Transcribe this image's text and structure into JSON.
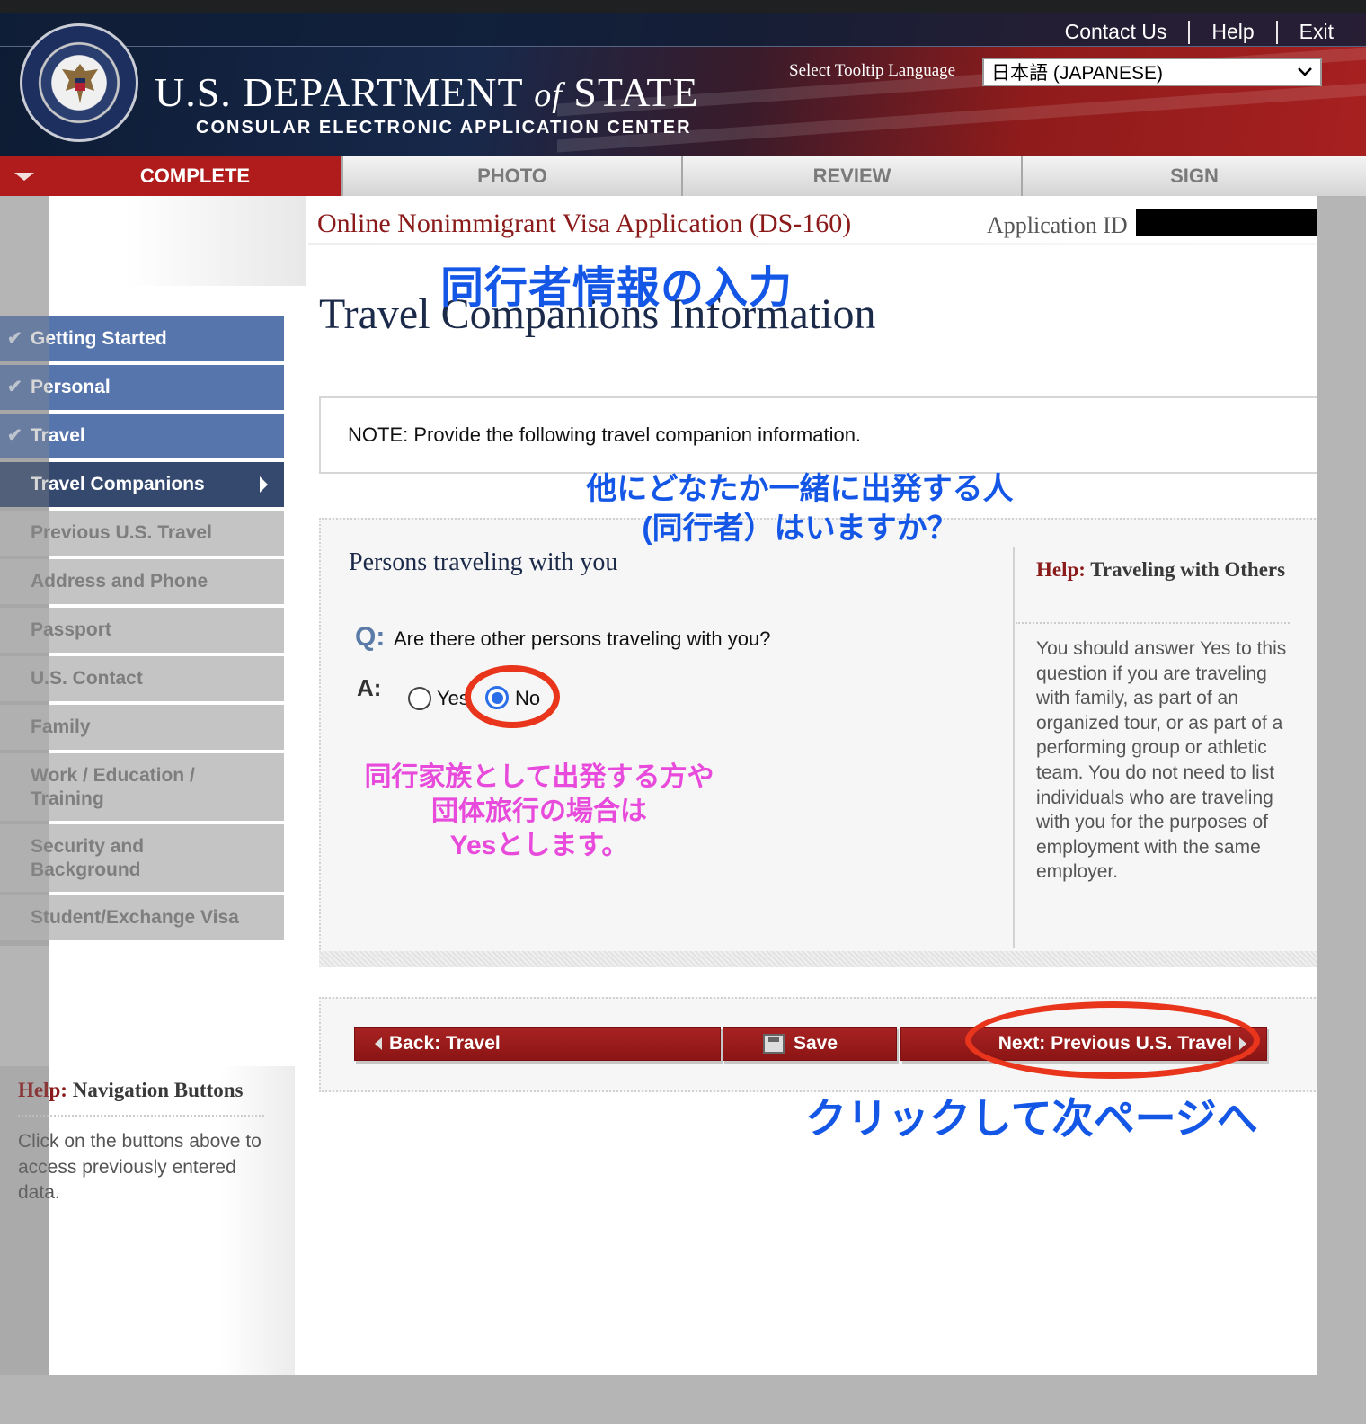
{
  "header": {
    "links": [
      "Contact Us",
      "Help",
      "Exit"
    ],
    "dept_title_part1": "U.S. DEPARTMENT",
    "dept_title_of": "of",
    "dept_title_part2": "STATE",
    "dept_subtitle": "CONSULAR ELECTRONIC APPLICATION CENTER",
    "tooltip_label": "Select Tooltip Language",
    "tooltip_value": "日本語 (JAPANESE)"
  },
  "tabs": [
    {
      "label": "COMPLETE",
      "active": true
    },
    {
      "label": "PHOTO",
      "active": false
    },
    {
      "label": "REVIEW",
      "active": false
    },
    {
      "label": "SIGN",
      "active": false
    }
  ],
  "app": {
    "title": "Online Nonimmigrant Visa Application (DS-160)",
    "id_label": "Application ID"
  },
  "page": {
    "title": "Travel Companions Information",
    "note": "NOTE: Provide the following travel companion information.",
    "section_label": "Persons traveling with you",
    "q_mark": "Q:",
    "question": "Are there other persons traveling with you?",
    "a_mark": "A:",
    "options": [
      "Yes",
      "No"
    ],
    "selected": "No"
  },
  "help": {
    "label": "Help:",
    "title": "Traveling with Others",
    "body": "You should answer Yes to this question if you are traveling with family, as part of an organized tour, or as part of a performing group or athletic team. You do not need to list individuals who are traveling with you for the purposes of employment with the same employer."
  },
  "sidebar": {
    "items": [
      {
        "label": "Getting Started",
        "state": "done"
      },
      {
        "label": "Personal",
        "state": "done"
      },
      {
        "label": "Travel",
        "state": "done"
      },
      {
        "label": "Travel Companions",
        "state": "current"
      },
      {
        "label": "Previous U.S. Travel",
        "state": "todo"
      },
      {
        "label": "Address and Phone",
        "state": "todo"
      },
      {
        "label": "Passport",
        "state": "todo"
      },
      {
        "label": "U.S. Contact",
        "state": "todo"
      },
      {
        "label": "Family",
        "state": "todo"
      },
      {
        "label": "Work / Education / Training",
        "state": "todo"
      },
      {
        "label": "Security and Background",
        "state": "todo"
      },
      {
        "label": "Student/Exchange Visa",
        "state": "todo"
      }
    ]
  },
  "nav_help": {
    "label": "Help:",
    "title": "Navigation Buttons",
    "body": "Click on the buttons above to access previously entered data."
  },
  "nav": {
    "back": "Back: Travel",
    "save": "Save",
    "next": "Next: Previous U.S. Travel"
  },
  "annotations": {
    "title_jp": "同行者情報の入力",
    "question_jp_line1": "他にどなたか一緒に出発する人",
    "question_jp_line2": "(同行者）はいますか？",
    "hint_jp_line1": "同行家族として出発する方や",
    "hint_jp_line2": "団体旅行の場合は",
    "hint_jp_line3": "Yesとします。",
    "next_jp": "クリックして次ページへ"
  },
  "colors": {
    "accent_red": "#b01c1c",
    "nav_blue": "#5775ad",
    "nav_current": "#35496f",
    "annotation_blue": "#1457e6",
    "annotation_pink": "#e84adb",
    "highlight_ring": "#e8351b"
  }
}
